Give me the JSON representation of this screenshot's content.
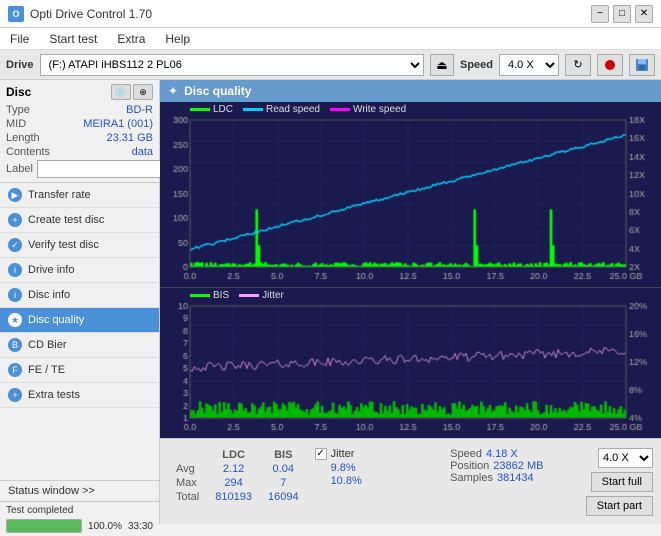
{
  "titlebar": {
    "icon": "O",
    "title": "Opti Drive Control 1.70",
    "btn_minimize": "−",
    "btn_maximize": "□",
    "btn_close": "✕"
  },
  "menubar": {
    "items": [
      "File",
      "Start test",
      "Extra",
      "Help"
    ]
  },
  "drivebar": {
    "label": "Drive",
    "drive_value": "(F:) ATAPI iHBS112 2 PL06",
    "eject_icon": "⏏",
    "speed_label": "Speed",
    "speed_value": "4.0 X",
    "icons": [
      "↻",
      "●",
      "💾"
    ]
  },
  "disc": {
    "label": "Disc",
    "type_key": "Type",
    "type_val": "BD-R",
    "mid_key": "MID",
    "mid_val": "MEIRA1 (001)",
    "length_key": "Length",
    "length_val": "23.31 GB",
    "contents_key": "Contents",
    "contents_val": "data",
    "label_key": "Label",
    "label_val": ""
  },
  "nav": {
    "items": [
      {
        "id": "transfer-rate",
        "label": "Transfer rate",
        "active": false
      },
      {
        "id": "create-test-disc",
        "label": "Create test disc",
        "active": false
      },
      {
        "id": "verify-test-disc",
        "label": "Verify test disc",
        "active": false
      },
      {
        "id": "drive-info",
        "label": "Drive info",
        "active": false
      },
      {
        "id": "disc-info",
        "label": "Disc info",
        "active": false
      },
      {
        "id": "disc-quality",
        "label": "Disc quality",
        "active": true
      },
      {
        "id": "cd-bier",
        "label": "CD Bier",
        "active": false
      },
      {
        "id": "fe-te",
        "label": "FE / TE",
        "active": false
      },
      {
        "id": "extra-tests",
        "label": "Extra tests",
        "active": false
      }
    ]
  },
  "status": {
    "window_label": "Status window >>",
    "progress_pct": 100,
    "status_text": "Test completed",
    "time_text": "33:30"
  },
  "chart": {
    "title": "Disc quality",
    "legend_top": [
      {
        "label": "LDC",
        "color": "#00ff00"
      },
      {
        "label": "Read speed",
        "color": "#00ccff"
      },
      {
        "label": "Write speed",
        "color": "#ff00ff"
      }
    ],
    "legend_bottom": [
      {
        "label": "BIS",
        "color": "#00ff00"
      },
      {
        "label": "Jitter",
        "color": "#ff99ff"
      }
    ],
    "top_y_right": [
      "18X",
      "16X",
      "14X",
      "12X",
      "10X",
      "8X",
      "6X",
      "4X",
      "2X"
    ],
    "top_y_left": [
      "300",
      "250",
      "200",
      "150",
      "100",
      "50",
      "0"
    ],
    "bottom_y_right": [
      "20%",
      "16%",
      "12%",
      "8%",
      "4%"
    ],
    "bottom_y_left_top": "10",
    "bottom_y_left_bot": "1",
    "x_labels": [
      "0.0",
      "2.5",
      "5.0",
      "7.5",
      "10.0",
      "12.5",
      "15.0",
      "17.5",
      "20.0",
      "22.5",
      "25.0 GB"
    ]
  },
  "stats": {
    "col_ldc": "LDC",
    "col_bis": "BIS",
    "row_avg": "Avg",
    "row_max": "Max",
    "row_total": "Total",
    "avg_ldc": "2.12",
    "avg_bis": "0.04",
    "max_ldc": "294",
    "max_bis": "7",
    "total_ldc": "810193",
    "total_bis": "16094",
    "jitter_label": "Jitter",
    "jitter_avg": "9.8%",
    "jitter_max": "10.8%",
    "jitter_total": "",
    "speed_label": "Speed",
    "speed_val": "4.18 X",
    "position_label": "Position",
    "position_val": "23862 MB",
    "samples_label": "Samples",
    "samples_val": "381434",
    "speed_select": "4.0 X",
    "btn_start_full": "Start full",
    "btn_start_part": "Start part"
  }
}
